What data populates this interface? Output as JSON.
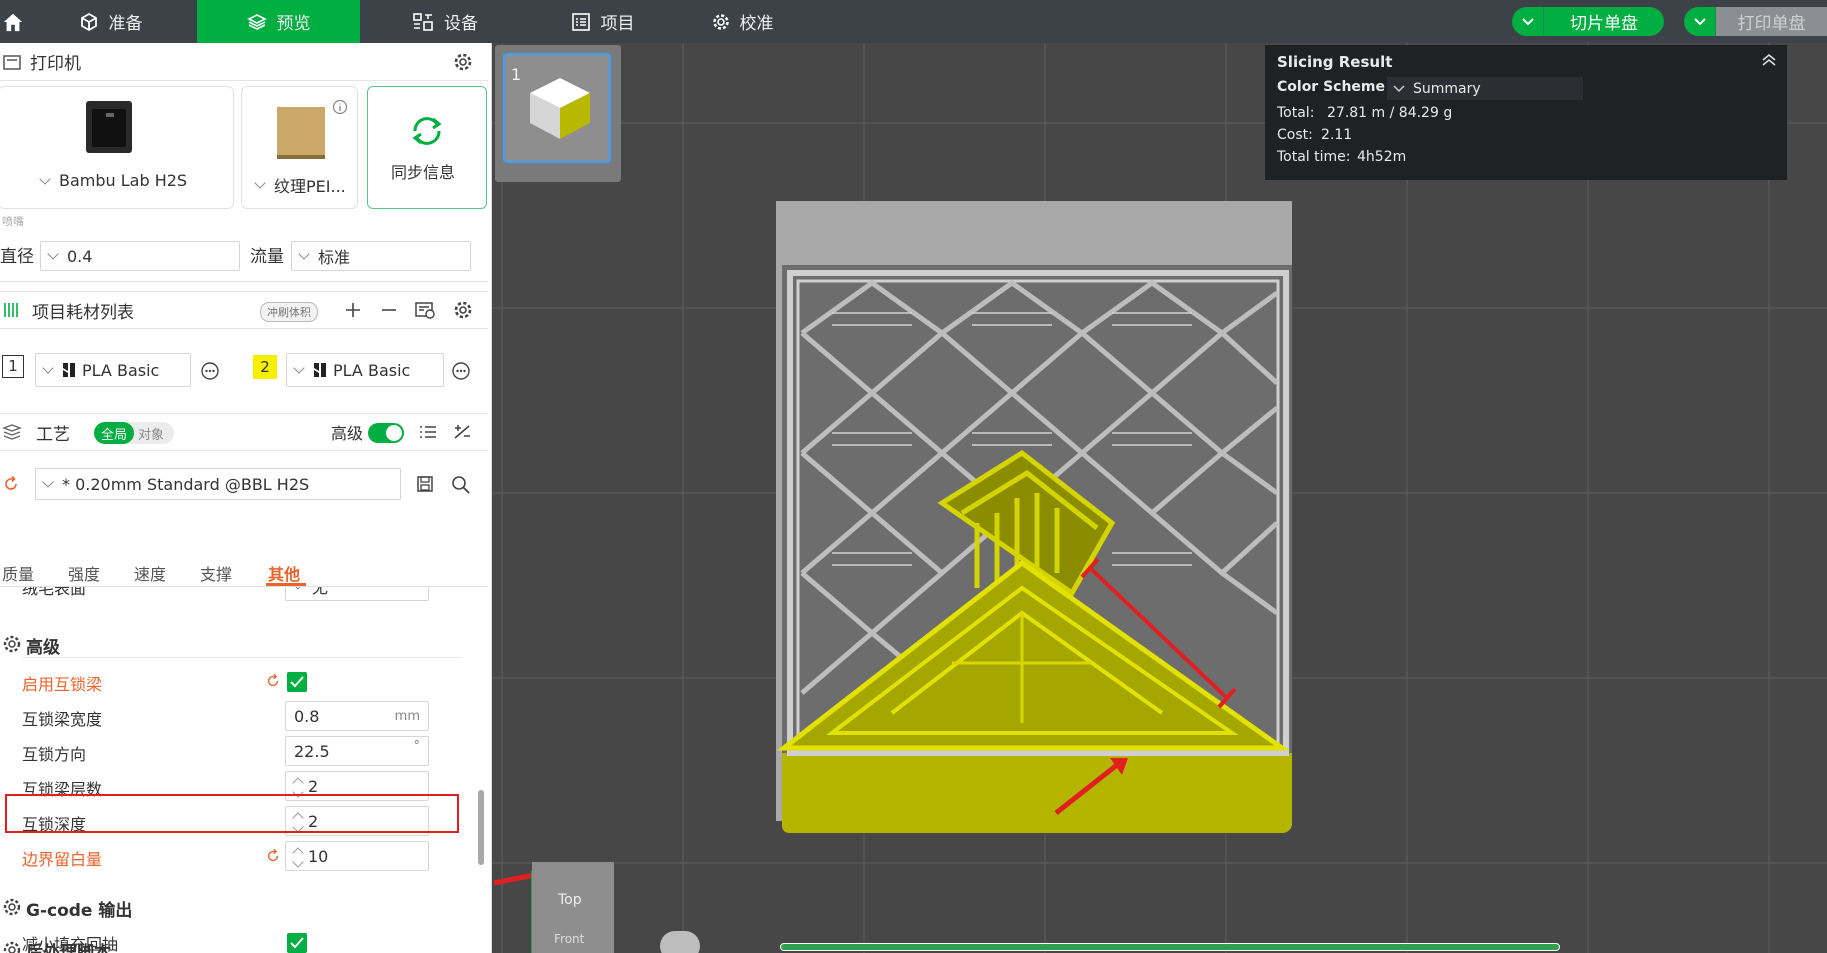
{
  "topbar": {
    "tabs": [
      {
        "label": "准备",
        "icon": "cube-outline-icon"
      },
      {
        "label": "预览",
        "icon": "layers-icon",
        "active": true
      },
      {
        "label": "设备",
        "icon": "device-grid-icon"
      },
      {
        "label": "项目",
        "icon": "list-icon"
      },
      {
        "label": "校准",
        "icon": "gear-icon"
      }
    ],
    "slice_button": "切片单盘",
    "print_button": "打印单盘"
  },
  "printer": {
    "section_title": "打印机",
    "printer_name": "Bambu Lab H2S",
    "plate_name": "纹理PEI...",
    "sync_label": "同步信息",
    "nozzle_group_label": "喷嘴",
    "diameter_label": "直径",
    "diameter_value": "0.4",
    "flow_label": "流量",
    "flow_value": "标准"
  },
  "filaments": {
    "section_title": "项目耗材列表",
    "flush_badge": "冲刷体积",
    "items": [
      {
        "index": "1",
        "name": "PLA Basic",
        "color": "#ffffff"
      },
      {
        "index": "2",
        "name": "PLA Basic",
        "color": "#f4f000"
      }
    ]
  },
  "process": {
    "section_title": "工艺",
    "scope_global": "全局",
    "scope_object": "对象",
    "advanced_label": "高级",
    "preset": "* 0.20mm Standard @BBL H2S",
    "tabs": [
      "质量",
      "强度",
      "速度",
      "支撑",
      "其他"
    ],
    "active_tab": "其他",
    "fuzzy_label": "绒毛表面",
    "fuzzy_value": "无",
    "advanced_group": "高级",
    "interlocking_enable_label": "启用互锁梁",
    "interlocking_width_label": "互锁梁宽度",
    "interlocking_width_value": "0.8",
    "interlocking_width_unit": "mm",
    "interlocking_orientation_label": "互锁方向",
    "interlocking_orientation_value": "22.5",
    "interlocking_orientation_unit": "°",
    "interlocking_layers_label": "互锁梁层数",
    "interlocking_layers_value": "2",
    "interlocking_depth_label": "互锁深度",
    "interlocking_depth_value": "2",
    "boundary_avoidance_label": "边界留白量",
    "boundary_avoidance_value": "10",
    "gcode_group": "G-code 输出",
    "reduce_retraction_label": "减小填充回抽",
    "post_process_group": "后处理脚本"
  },
  "slicing_result": {
    "title": "Slicing Result",
    "color_scheme_label": "Color Scheme",
    "color_scheme_value": "Summary",
    "total_label": "Total:",
    "total_value": "27.81 m / 84.29 g",
    "cost_label": "Cost:",
    "cost_value": "2.11",
    "time_label": "Total time:",
    "time_value": "4h52m"
  },
  "plate": {
    "index": "1"
  },
  "navcube": {
    "top": "Top",
    "front": "Front"
  },
  "colors": {
    "accent": "#00ae42",
    "orange": "#e8642c",
    "model_yellow": "#c8c800"
  }
}
